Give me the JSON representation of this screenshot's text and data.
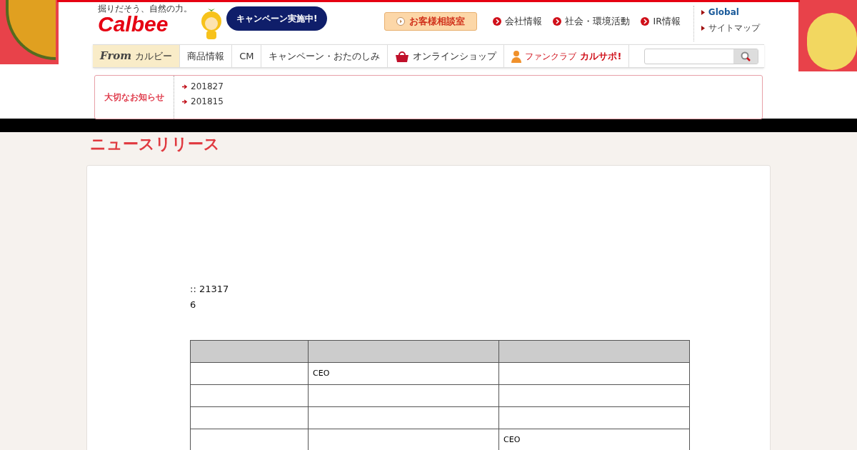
{
  "header": {
    "tagline": "掘りだそう、自然の力。",
    "logo": "Calbee",
    "campaign_bubble": "キャンペーン実施中!",
    "consult_button": "お客様相談室",
    "top_links": [
      "会社情報",
      "社会・環境活動",
      "IR情報"
    ],
    "side_links": [
      "Global",
      "サイトマップ"
    ]
  },
  "nav": [
    {
      "kind": "from",
      "prefix": "From",
      "label": "カルビー",
      "selected": true
    },
    {
      "kind": "text",
      "label": "商品情報",
      "selected": false
    },
    {
      "kind": "text",
      "label": "CM",
      "selected": false
    },
    {
      "kind": "text",
      "label": "キャンペーン・おたのしみ",
      "selected": false
    },
    {
      "kind": "shop",
      "label": "オンラインショップ",
      "selected": false
    },
    {
      "kind": "fan",
      "label": "ファンクラブ",
      "accent": "カルサポ!",
      "selected": false
    }
  ],
  "notice": {
    "title": "大切なお知らせ",
    "items": [
      "201827",
      "201815"
    ]
  },
  "page_title": "ニュースリリース",
  "article": {
    "lines": [
      ":: 21317",
      "6"
    ],
    "table": {
      "rows": [
        [
          null,
          "CEO",
          null
        ],
        [
          null,
          null,
          null
        ],
        [
          null,
          null,
          null
        ],
        [
          null,
          null,
          "CEO"
        ]
      ]
    }
  }
}
